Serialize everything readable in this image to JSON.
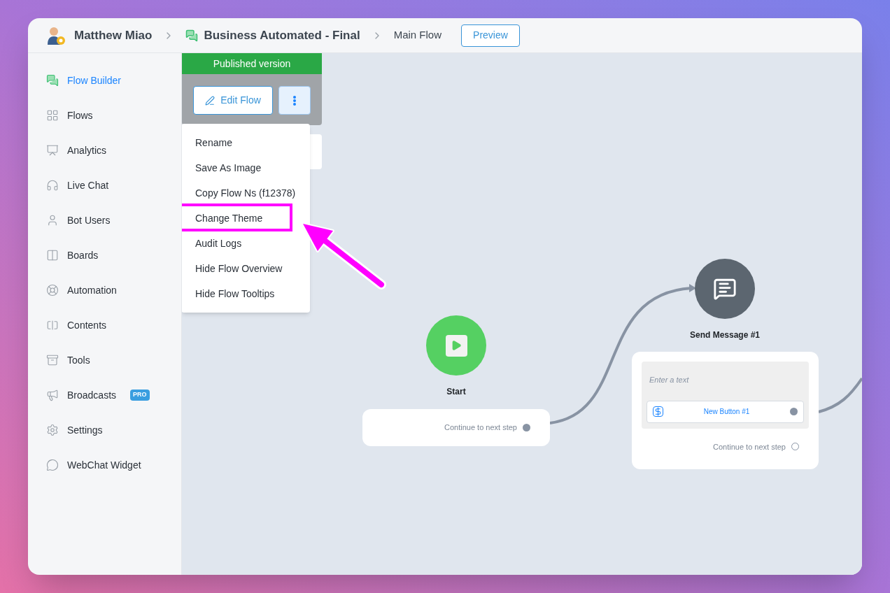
{
  "breadcrumb": [
    {
      "kind": "account",
      "label": "Matthew Miao"
    },
    {
      "kind": "bot",
      "label": "Business Automated - Final"
    },
    {
      "kind": "plain",
      "label": "Main Flow"
    }
  ],
  "preview_button": "Preview",
  "sidebar": {
    "items": [
      {
        "label": "Flow Builder",
        "selected": true
      },
      {
        "label": "Flows",
        "selected": false
      },
      {
        "label": "Analytics",
        "selected": false
      },
      {
        "label": "Live Chat",
        "selected": false
      },
      {
        "label": "Bot Users",
        "selected": false
      },
      {
        "label": "Boards",
        "selected": false
      },
      {
        "label": "Automation",
        "selected": false
      },
      {
        "label": "Contents",
        "selected": false
      },
      {
        "label": "Tools",
        "selected": false
      },
      {
        "label": "Broadcasts",
        "selected": false,
        "badge": "PRO"
      },
      {
        "label": "Settings",
        "selected": false
      },
      {
        "label": "WebChat Widget",
        "selected": false
      }
    ]
  },
  "version_panel": {
    "title": "Published version",
    "edit_button": "Edit Flow"
  },
  "menu": {
    "items": [
      {
        "label": "Rename",
        "highlighted": false
      },
      {
        "label": "Save As Image",
        "highlighted": false
      },
      {
        "label": "Copy Flow Ns (f12378)",
        "highlighted": false
      },
      {
        "label": "Change Theme",
        "highlighted": true
      },
      {
        "label": "Audit Logs",
        "highlighted": false
      },
      {
        "label": "Hide Flow Overview",
        "highlighted": false
      },
      {
        "label": "Hide Flow Tooltips",
        "highlighted": false
      }
    ]
  },
  "nodes": [
    {
      "kind": "start",
      "title": "Start",
      "continue": "Continue to next step",
      "connected": true
    },
    {
      "kind": "message",
      "title": "Send Message #1",
      "placeholder": "Enter a text",
      "button": "New Button #1",
      "continue": "Continue to next step",
      "connected": false
    }
  ]
}
